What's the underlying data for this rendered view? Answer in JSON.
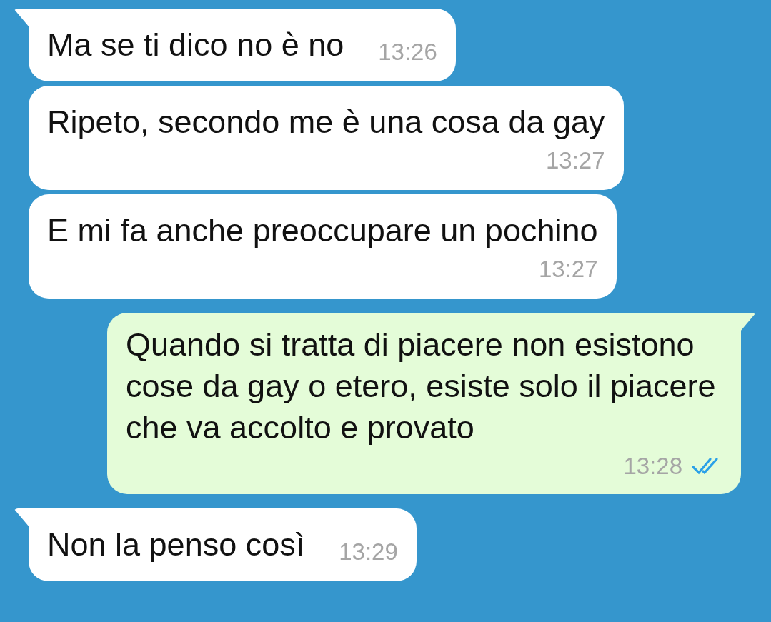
{
  "messages": [
    {
      "kind": "incoming",
      "tail": true,
      "time_below": false,
      "text": "Ma se ti dico no è no",
      "time": "13:26"
    },
    {
      "kind": "incoming",
      "tail": false,
      "time_below": true,
      "text": "Ripeto, secondo me è una cosa da gay",
      "time": "13:27"
    },
    {
      "kind": "incoming",
      "tail": false,
      "time_below": true,
      "text": "E mi fa anche preoccupare un pochino",
      "time": "13:27"
    },
    {
      "kind": "outgoing",
      "tail": true,
      "time_below": true,
      "text": "Quando si tratta di piacere non esistono cose da gay o etero, esiste solo il piacere che va accolto e provato",
      "time": "13:28",
      "read": true
    },
    {
      "kind": "incoming",
      "tail": true,
      "time_below": false,
      "text": "Non la penso così",
      "time": "13:29"
    }
  ]
}
